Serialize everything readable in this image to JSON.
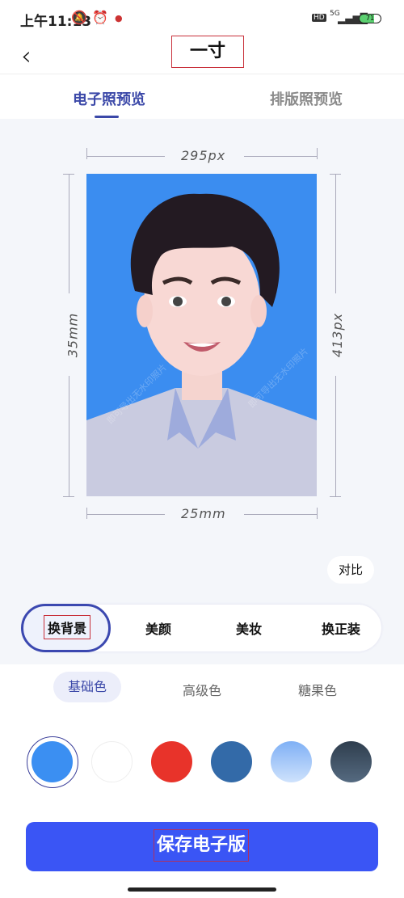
{
  "status_bar": {
    "time": "上午11:13",
    "network": "5G",
    "battery": "71"
  },
  "header": {
    "back_icon": "chevron-left-icon",
    "title": "一寸"
  },
  "tabs": [
    {
      "label": "电子照预览",
      "active": true
    },
    {
      "label": "排版照预览",
      "active": false
    }
  ],
  "preview": {
    "width_px": "295px",
    "height_px": "413px",
    "width_mm": "25mm",
    "height_mm": "35mm",
    "watermark": "即可导出无水印照片",
    "background_color": "#3b8df0"
  },
  "compare_button": "对比",
  "tools": [
    {
      "label": "换背景",
      "active": true
    },
    {
      "label": "美颜"
    },
    {
      "label": "美妆"
    },
    {
      "label": "换正装"
    }
  ],
  "color_categories": [
    {
      "label": "基础色",
      "active": true
    },
    {
      "label": "高级色"
    },
    {
      "label": "糖果色"
    }
  ],
  "swatches": [
    {
      "color": "#3b8ff2",
      "selected": true
    },
    {
      "color": "#ffffff"
    },
    {
      "color": "#e8332a"
    },
    {
      "color": "#336aa8"
    },
    {
      "color": "light-blue-gradient"
    },
    {
      "color": "dark-slate-gradient"
    }
  ],
  "save_button": "保存电子版",
  "accent_color": "#3a55f5"
}
